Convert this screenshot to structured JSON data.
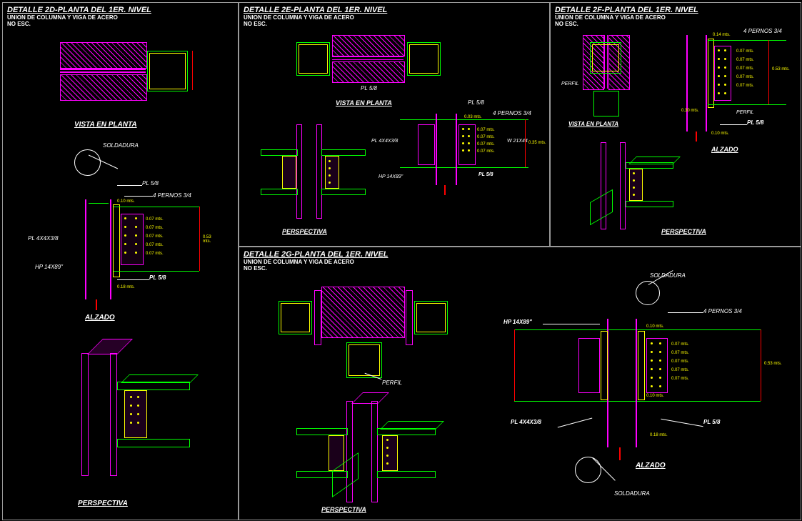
{
  "panels": {
    "p2d": {
      "title": "DETALLE 2D-PLANTA DEL 1ER. NIVEL",
      "subtitle1": "UNION DE COLUMNA Y VIGA DE ACERO",
      "subtitle2": "NO ESC.",
      "views": {
        "planta": "VISTA EN PLANTA",
        "alzado": "ALZADO",
        "perspectiva": "PERSPECTIVA"
      },
      "labels": {
        "soldadura": "SOLDADURA",
        "pl58": "PL 5/8",
        "pernos": "4 PERNOS 3/4",
        "pl4x4": "PL 4X4X3/8",
        "hp": "HP 14X89\"",
        "dim1": "0.10 mts.",
        "dim2": "0.07 mts.",
        "dim3": "0.18 mts.",
        "dim4": "0.53 mts."
      }
    },
    "p2e": {
      "title": "DETALLE 2E-PLANTA DEL 1ER. NIVEL",
      "subtitle1": "UNION DE COLUMNA Y VIGA DE ACERO",
      "subtitle2": "NO ESC.",
      "views": {
        "planta": "VISTA EN PLANTA",
        "perspectiva": "PERSPECTIVA"
      },
      "labels": {
        "pl58": "PL 5/8",
        "pernos": "4 PERNOS 3/4",
        "pl4x4": "PL 4X4X3/8",
        "hp": "HP 14X89\"",
        "w21": "W 21X44",
        "dim1": "0.03 mts.",
        "dim2": "0.07 mts.",
        "dim3": "0.35 mts.",
        "pl5b": "PL 5/8"
      }
    },
    "p2f": {
      "title": "DETALLE 2F-PLANTA DEL 1ER. NIVEL",
      "subtitle1": "UNION DE COLUMNA Y VIGA DE ACERO",
      "subtitle2": "NO ESC.",
      "views": {
        "planta": "VISTA EN PLANTA",
        "alzado": "ALZADO",
        "perspectiva": "PERSPECTIVA"
      },
      "labels": {
        "pernos": "4 PERNOS 3/4",
        "pl58": "PL 5/8",
        "perfil": "PERFIL",
        "dim1": "0.07 mts.",
        "dim2": "0.10 mts.",
        "dim3": "0.14 mts.",
        "dim4": "0.53 mts.",
        "dim5": "0.30 mts."
      }
    },
    "p2g": {
      "title": "DETALLE 2G-PLANTA DEL 1ER. NIVEL",
      "subtitle1": "UNION DE COLUMNA Y VIGA DE ACERO",
      "subtitle2": "NO ESC.",
      "views": {
        "alzado": "ALZADO",
        "perspectiva": "PERSPECTIVA"
      },
      "labels": {
        "soldadura": "SOLDADURA",
        "pernos": "4 PERNOS 3/4",
        "hp": "HP 14X89\"",
        "pl4x4": "PL 4X4X3/8",
        "pl58": "PL 5/8",
        "perfil": "PERFIL",
        "dim1": "0.07 mts.",
        "dim2": "0.10 mts.",
        "dim3": "0.18 mts.",
        "dim4": "0.53 mts.",
        "dim5": "0.10 mts."
      }
    }
  }
}
